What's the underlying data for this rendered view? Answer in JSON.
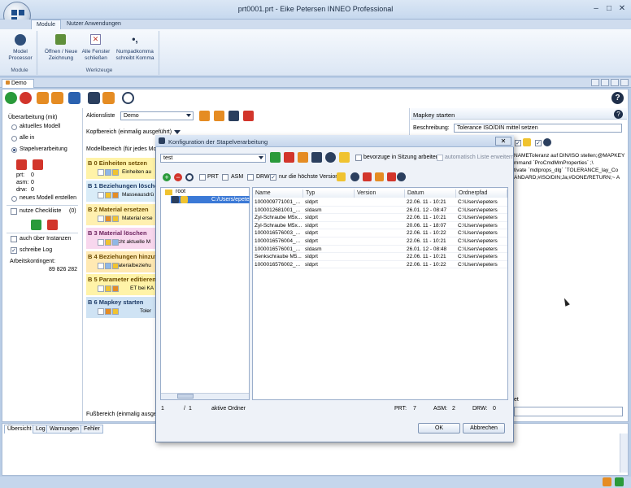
{
  "window": {
    "title": "prt0001.prt - Eike Petersen INNEO Professional"
  },
  "ribbon": {
    "tabs": [
      "Module",
      "Nutzer Anwendungen"
    ],
    "buttons": {
      "model_processor": [
        "Model",
        "Processor"
      ],
      "open_new": [
        "Öffnen / Neue",
        "Zeichnung"
      ],
      "close_all": [
        "Alle Fenster",
        "schließen"
      ],
      "numpad": [
        "Numpadkomma",
        "schreibt Komma"
      ]
    },
    "groups": {
      "module": "Module",
      "werkzeuge": "Werkzeuge"
    }
  },
  "doc_tab": "Demo",
  "left": {
    "header": "Überarbeitung (mit)",
    "options": [
      "aktuelles Modell",
      "alle in",
      "Stapelverarbeitung"
    ],
    "prt": "prt:",
    "prt_v": "0",
    "asm": "asm:",
    "asm_v": "0",
    "drw": "drw:",
    "drw_v": "0",
    "new_model": "neues Modell erstellen",
    "checklist": "nutze Checkliste",
    "checklist_count": "(0)",
    "instances": "auch über Instanzen",
    "log": "schreibe Log",
    "contingent_label": "Arbeitskontingent:",
    "contingent_value": "89 826 282"
  },
  "mid": {
    "aktionsliste_label": "Aktionsliste",
    "aktionsliste_value": "Demo",
    "kopfbereich": "Kopfbereich (einmalig ausgeführt)",
    "modellbereich": "Modellbereich (für jedes Mod",
    "fussbereich": "Fußbereich (einmalig ausgefü",
    "blocks": [
      {
        "title": "B 0  Einheiten setzen",
        "sub": "Einheiten au",
        "bg": "#fff3a8"
      },
      {
        "title": "B 1  Beziehungen löschen",
        "sub": "Masseausdrü",
        "bg": "#d9ecf8"
      },
      {
        "title": "B 2  Material ersetzen",
        "sub": "Material erse",
        "bg": "#fff0b0"
      },
      {
        "title": "B 3  Material löschen",
        "sub": "nicht aktuelle M",
        "bg": "#f8d7ee"
      },
      {
        "title": "B 4  Beziehungen hinzufü",
        "sub": "Materialbeziehu",
        "bg": "#ffe9b3"
      },
      {
        "title": "B 5  Parameter editieren",
        "sub": "ET bei KA",
        "bg": "#fff3a8"
      },
      {
        "title": "B 6  Mapkey starten",
        "sub": "Toler",
        "bg": "#cfe3f4"
      }
    ]
  },
  "right": {
    "header": "Mapkey starten",
    "desc_label": "Beschreibung:",
    "desc_value": "Tolerance ISO/DIN mittel setzen",
    "code_lines": [
      "NAMEToleranz auf DIN/ISO stellen;@MAPKEY",
      "mmand `ProCmdMmProperties` ;\\",
      "tivate `mdlprops_dlg` `TOLERANCE_lay_Co",
      "ANDARD;#ISO/DIN;Ja;#DONE/RETURN;~ A"
    ],
    "partial_label": "et"
  },
  "bottom_tabs": [
    "Übersicht",
    "Log",
    "Warnungen",
    "Fehler"
  ],
  "dialog": {
    "title": "Konfiguration der Stapelverarbeitung",
    "list_value": "test",
    "chk_session": "bevorzuge in Sitzung arbeiten",
    "chk_extend": "automatisch Liste erweitern",
    "filters": [
      "PRT",
      "ASM",
      "DRW",
      "nur die höchste Version"
    ],
    "tree": {
      "root": "root",
      "path": "C:/Users/epete"
    },
    "columns": [
      "Name",
      "Typ",
      "Version",
      "Datum",
      "Ordnerpfad"
    ],
    "rows": [
      [
        "1000009771001_...",
        "sldprt",
        "",
        "22.06. 11 - 10:21",
        "C:\\Users\\epeters"
      ],
      [
        "1000012681001_...",
        "sldasm",
        "",
        "26.01. 12 - 08:47",
        "C:\\Users\\epeters"
      ],
      [
        "Zyl-Schraube M5x...",
        "sldprt",
        "",
        "22.06. 11 - 10:21",
        "C:\\Users\\epeters"
      ],
      [
        "Zyl-Schraube M5x...",
        "sldprt",
        "",
        "20.06. 11 - 18:07",
        "C:\\Users\\epeters"
      ],
      [
        "1000016576003_...",
        "sldprt",
        "",
        "22.06. 11 - 10:22",
        "C:\\Users\\epeters"
      ],
      [
        "1000016576004_...",
        "sldprt",
        "",
        "22.06. 11 - 10:21",
        "C:\\Users\\epeters"
      ],
      [
        "1000016576001_...",
        "sldasm",
        "",
        "26.01. 12 - 08:48",
        "C:\\Users\\epeters"
      ],
      [
        "Senkschraube M5...",
        "sldprt",
        "",
        "22.06. 11 - 10:21",
        "C:\\Users\\epeters"
      ],
      [
        "1000016576002_...",
        "sldprt",
        "",
        "22.06. 11 - 10:22",
        "C:\\Users\\epeters"
      ]
    ],
    "footer": {
      "page": "1",
      "sep": "/",
      "total": "1",
      "active": "aktive Ordner",
      "prt_label": "PRT:",
      "prt": "7",
      "asm_label": "ASM:",
      "asm": "2",
      "drw_label": "DRW:",
      "drw": "0"
    },
    "ok": "OK",
    "cancel": "Abbrechen"
  }
}
